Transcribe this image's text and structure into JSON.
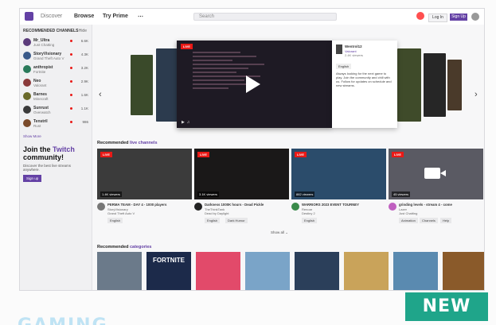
{
  "topbar": {
    "nav": [
      "Discover",
      "Browse",
      "Try Prime",
      "⋯"
    ],
    "search_placeholder": "Search",
    "login": "Log In",
    "signup": "Sign Up"
  },
  "sidebar": {
    "heading": "RECOMMENDED CHANNELS",
    "hide": "Hide",
    "items": [
      {
        "name": "Mr_Ultra",
        "game": "Just Chatting",
        "viewers": "6.6K"
      },
      {
        "name": "StoryVisionary",
        "game": "Grand Theft Auto V",
        "viewers": "4.3K"
      },
      {
        "name": "anthropist",
        "game": "Fortnite",
        "viewers": "3.2K"
      },
      {
        "name": "Neo",
        "game": "Valorant",
        "viewers": "2.9K"
      },
      {
        "name": "Barnes",
        "game": "Minecraft",
        "viewers": "1.6K"
      },
      {
        "name": "Sunrust",
        "game": "Overwatch",
        "viewers": "1.1K"
      },
      {
        "name": "Tenstril",
        "game": "Rust",
        "viewers": "986"
      }
    ],
    "show_more": "Show More",
    "join_title_1": "Join the ",
    "join_title_brand": "Twitch",
    "join_title_2": " community!",
    "join_desc": "Discover the best live streams anywhere.",
    "join_button": "Sign up"
  },
  "hero": {
    "live": "LIVE",
    "streamer": "Wentrol12",
    "game": "Valorant",
    "viewers": "2.4K viewers",
    "tag": "English",
    "description": "Always looking for the next game to play. Join the community and chill with us. Follow for updates on schedule and new streams."
  },
  "recommended": {
    "title_1": "Recommended ",
    "title_2": "live channels",
    "show_all": "Show all",
    "cards": [
      {
        "live": "LIVE",
        "viewers": "1.4K viewers",
        "title": "PERMA TEAM - DAY 4 - 1000 players",
        "name": "StoryVisionary",
        "game": "Grand Theft Auto V",
        "tags": [
          "English"
        ]
      },
      {
        "live": "LIVE",
        "viewers": "3.1K viewers",
        "title": "Darkness 1000K hours - Dead Pickle",
        "name": "TheThinkTank",
        "game": "Dead by Daylight",
        "tags": [
          "English",
          "Dark Humor"
        ]
      },
      {
        "live": "LIVE",
        "viewers": "882 viewers",
        "title": "WARRIORS 2023 EVENT TOURNEY",
        "name": "Renoar",
        "game": "Destiny 2",
        "tags": [
          "English"
        ]
      },
      {
        "live": "LIVE",
        "viewers": "45 viewers",
        "title": "grinding levels - stream 4 - come",
        "name": "Lazer",
        "game": "Just Chatting",
        "tags": [
          "Animation",
          "Channels",
          "Help"
        ]
      }
    ]
  },
  "categories": {
    "title_1": "Recommended ",
    "title_2": "categories",
    "fortnite_label": "FORTNITE"
  },
  "badge": "NEW",
  "bottom_text": "GAMING"
}
